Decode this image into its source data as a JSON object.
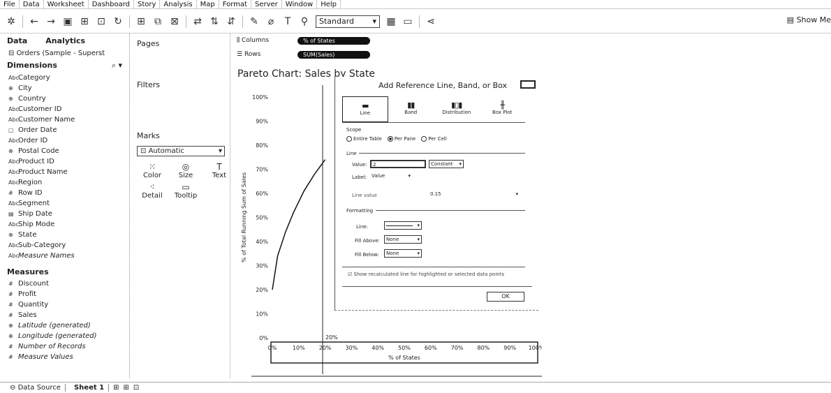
{
  "menu": [
    "File",
    "Data",
    "Worksheet",
    "Dashboard",
    "Story",
    "Analysis",
    "Map",
    "Format",
    "Server",
    "Window",
    "Help"
  ],
  "toolbar": {
    "mark_type_select": "Standard",
    "show_me_label": "Show Me"
  },
  "data_pane": {
    "tab_data": "Data",
    "tab_analytics": "Analytics",
    "source": "Orders (Sample - Superst",
    "dimensions_header": "Dimensions",
    "dimensions": [
      {
        "icon": "Abc",
        "label": "Category"
      },
      {
        "icon": "⊕",
        "label": "City"
      },
      {
        "icon": "⊕",
        "label": "Country"
      },
      {
        "icon": "Abc",
        "label": "Customer ID"
      },
      {
        "icon": "Abc",
        "label": "Customer Name"
      },
      {
        "icon": "▢",
        "label": "Order Date"
      },
      {
        "icon": "Abc",
        "label": "Order ID"
      },
      {
        "icon": "⊕",
        "label": "Postal Code"
      },
      {
        "icon": "Abc",
        "label": "Product ID"
      },
      {
        "icon": "Abc",
        "label": "Product Name"
      },
      {
        "icon": "Abc",
        "label": "Region"
      },
      {
        "icon": "#",
        "label": "Row ID"
      },
      {
        "icon": "Abc",
        "label": "Segment"
      },
      {
        "icon": "▤",
        "label": "Ship Date"
      },
      {
        "icon": "Abc",
        "label": "Ship Mode"
      },
      {
        "icon": "⊕",
        "label": "State"
      },
      {
        "icon": "Abc",
        "label": "Sub-Category"
      },
      {
        "icon": "Abc",
        "label": "Measure Names"
      }
    ],
    "measures_header": "Measures",
    "measures": [
      {
        "icon": "#",
        "label": "Discount"
      },
      {
        "icon": "#",
        "label": "Profit"
      },
      {
        "icon": "#",
        "label": "Quantity"
      },
      {
        "icon": "#",
        "label": "Sales"
      },
      {
        "icon": "⊕",
        "label": "Latitude (generated)"
      },
      {
        "icon": "⊕",
        "label": "Longitude (generated)"
      },
      {
        "icon": "#",
        "label": "Number of Records"
      },
      {
        "icon": "#",
        "label": "Measure Values"
      }
    ]
  },
  "shelves": {
    "pages": "Pages",
    "filters": "Filters",
    "marks": "Marks",
    "marks_type": "Automatic",
    "mark_cards": [
      {
        "icon": "⁙",
        "label": "Color"
      },
      {
        "icon": "◎",
        "label": "Size"
      },
      {
        "icon": "T",
        "label": "Text"
      },
      {
        "icon": "⁖",
        "label": "Detail"
      },
      {
        "icon": "▭",
        "label": "Tooltip"
      }
    ]
  },
  "columns_shelf": {
    "label": "Columns",
    "pill": "% of States"
  },
  "rows_shelf": {
    "label": "Rows",
    "pill": "SUM(Sales)"
  },
  "chart_data": {
    "type": "line",
    "title": "Pareto Chart: Sales by State",
    "xlabel": "% of States",
    "ylabel": "% of Total Running Sum of Sales",
    "x_ticks": [
      "0%",
      "10%",
      "20%",
      "30%",
      "40%",
      "50%",
      "60%",
      "70%",
      "80%",
      "90%",
      "100%"
    ],
    "y_ticks": [
      "0%",
      "10%",
      "20%",
      "30%",
      "40%",
      "50%",
      "60%",
      "70%",
      "80%",
      "90%",
      "100%"
    ],
    "reference_label": "20%",
    "series": [
      {
        "x": [
          0,
          2,
          5,
          8,
          12,
          16,
          20
        ],
        "y": [
          20,
          34,
          44,
          52,
          61,
          68,
          74
        ]
      }
    ],
    "xlim": [
      0,
      100
    ],
    "ylim": [
      0,
      100
    ]
  },
  "dialog": {
    "title": "Add Reference Line, Band, or Box",
    "types": [
      "Line",
      "Band",
      "Distribution",
      "Box Plot"
    ],
    "scope_label": "Scope",
    "scope_options": [
      "Entire Table",
      "Per Pane",
      "Per Cell"
    ],
    "line_label": "Line",
    "value_label": "Value:",
    "value_input": "2",
    "value_agg": "Constant",
    "label_label": "Label:",
    "label_value": "Value",
    "line_value_text": "Line value",
    "line_value_fmt": "0.15",
    "formatting_label": "Formatting",
    "line_fmt_label": "Line:",
    "fill_above_label": "Fill Above:",
    "fill_above_value": "None",
    "fill_below_label": "Fill Below:",
    "fill_below_value": "None",
    "recalc_text": "Show recalculated line for highlighted or selected data points",
    "ok_label": "OK"
  },
  "bottom": {
    "data_source": "Data Source",
    "sheet": "Sheet 1"
  }
}
